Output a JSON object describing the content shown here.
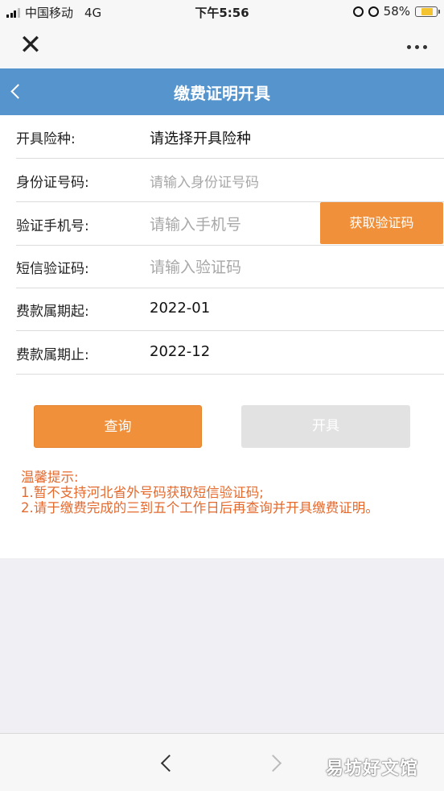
{
  "status_bar": {
    "carrier": "中国移动",
    "network": "4G",
    "time": "下午5:56",
    "battery": "58%",
    "battery_level": 0.58
  },
  "header": {
    "title": "缴费证明开具"
  },
  "form": {
    "insurance_type": {
      "label": "开具险种:",
      "value": "请选择开具险种"
    },
    "id_number": {
      "label": "身份证号码:",
      "placeholder": "请输入身份证号码"
    },
    "phone": {
      "label": "验证手机号:",
      "placeholder": "请输入手机号"
    },
    "sms_code": {
      "label": "短信验证码:",
      "placeholder": "请输入验证码"
    },
    "period_start": {
      "label": "费款属期起:",
      "value": "2022-01"
    },
    "period_end": {
      "label": "费款属期止:",
      "value": "2022-12"
    }
  },
  "buttons": {
    "get_code": "获取验证码",
    "query": "查询",
    "issue": "开具"
  },
  "tips": {
    "title": "温馨提示:",
    "line1": "1.暂不支持河北省外号码获取短信验证码;",
    "line2": "2.请于缴费完成的三到五个工作日后再查询并开具缴费证明。"
  },
  "watermark": "易坊好文馆",
  "colors": {
    "header_blue": "#5594cd",
    "accent_orange": "#f0903a",
    "tip_orange": "#e46a2e",
    "disabled_gray": "#e2e2e2"
  }
}
